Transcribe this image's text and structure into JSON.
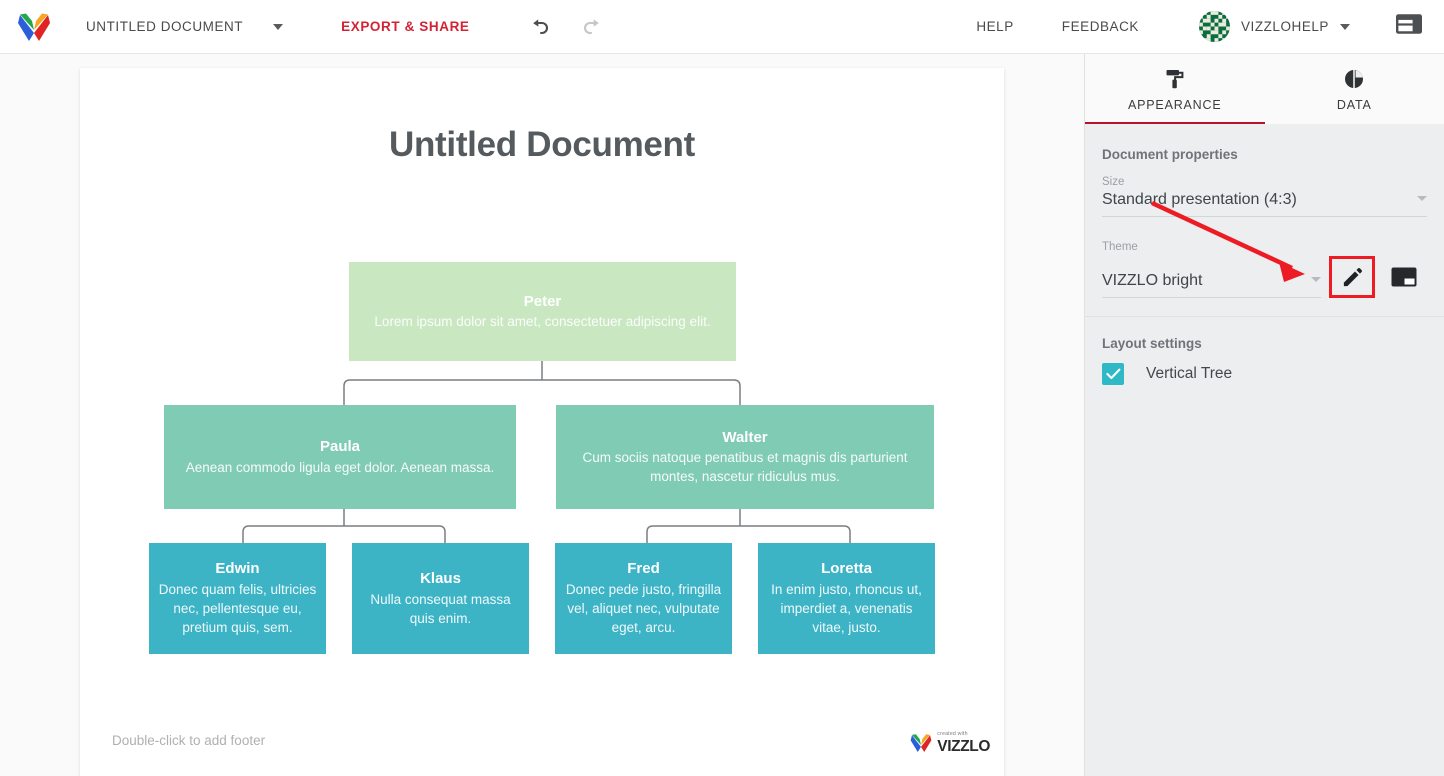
{
  "topbar": {
    "logo_icon": "vizzlo-v-logo",
    "document_title": "UNTITLED DOCUMENT",
    "document_title_caret_icon": "chevron-down-icon",
    "export_share_label": "EXPORT & SHARE",
    "undo_icon": "undo-arrow-icon",
    "redo_icon": "redo-arrow-icon",
    "help_label": "HELP",
    "feedback_label": "FEEDBACK",
    "user_name": "VIZZLOHELP",
    "user_caret_icon": "chevron-down-icon",
    "avatar_icon": "user-identicon-avatar",
    "panel_toggle_icon": "panel-layout-toggle-icon",
    "accent_red": "#d32234"
  },
  "slide": {
    "title": "Untitled Document",
    "footer_placeholder": "Double-click to add footer",
    "watermark": {
      "small_text": "created with",
      "big_text": "VIZZLO",
      "logo_icon": "vizzlo-v-logo"
    }
  },
  "chart_data": {
    "type": "tree",
    "title": "Untitled Document",
    "layout": "Vertical Tree",
    "levels": 3,
    "colors": {
      "level_0": "#c9e7c1",
      "level_1": "#80cbb4",
      "level_2": "#3cb4c6",
      "connector": "#7a7f82",
      "node_text": "#ffffff"
    },
    "nodes": [
      {
        "id": "peter",
        "level": 0,
        "name": "Peter",
        "description": "Lorem ipsum dolor sit amet, consectetuer adipiscing elit.",
        "parent": null,
        "color": "#c9e7c1"
      },
      {
        "id": "paula",
        "level": 1,
        "name": "Paula",
        "description": "Aenean commodo ligula eget dolor. Aenean massa.",
        "parent": "peter",
        "color": "#80cbb4"
      },
      {
        "id": "walter",
        "level": 1,
        "name": "Walter",
        "description": "Cum sociis natoque penatibus et magnis dis parturient montes, nascetur ridiculus mus.",
        "parent": "peter",
        "color": "#80cbb4"
      },
      {
        "id": "edwin",
        "level": 2,
        "name": "Edwin",
        "description": "Donec quam felis, ultricies nec, pellentesque eu, pretium quis, sem.",
        "parent": "paula",
        "color": "#3cb4c6"
      },
      {
        "id": "klaus",
        "level": 2,
        "name": "Klaus",
        "description": "Nulla consequat massa quis enim.",
        "parent": "paula",
        "color": "#3cb4c6"
      },
      {
        "id": "fred",
        "level": 2,
        "name": "Fred",
        "description": "Donec pede justo, fringilla vel, aliquet nec, vulputate eget, arcu.",
        "parent": "walter",
        "color": "#3cb4c6"
      },
      {
        "id": "loretta",
        "level": 2,
        "name": "Loretta",
        "description": "In enim justo, rhoncus ut, imperdiet a, venenatis vitae, justo.",
        "parent": "walter",
        "color": "#3cb4c6"
      }
    ]
  },
  "sidebar": {
    "tabs": [
      {
        "label": "APPEARANCE",
        "icon": "paint-roller-icon",
        "active": true
      },
      {
        "label": "DATA",
        "icon": "pie-chart-icon",
        "active": false
      }
    ],
    "active_tab_underline_color": "#b3142c",
    "document_properties": {
      "section_title": "Document properties",
      "size": {
        "label": "Size",
        "value": "Standard presentation (4:3)",
        "caret_icon": "chevron-down-icon"
      },
      "theme": {
        "label": "Theme",
        "value": "VIZZLO bright",
        "caret_icon": "chevron-down-icon",
        "edit_icon": "pencil-edit-icon",
        "background_icon": "background-image-icon",
        "edit_highlight_color": "#ed1c24"
      }
    },
    "layout_settings": {
      "section_title": "Layout settings",
      "checkbox_label": "Vertical Tree",
      "checkbox_checked": true,
      "checkbox_color": "#2fb8c6",
      "check_icon": "checkmark-icon"
    }
  },
  "annotation": {
    "arrow_color": "#ed1c24",
    "type": "pointer-arrow"
  }
}
